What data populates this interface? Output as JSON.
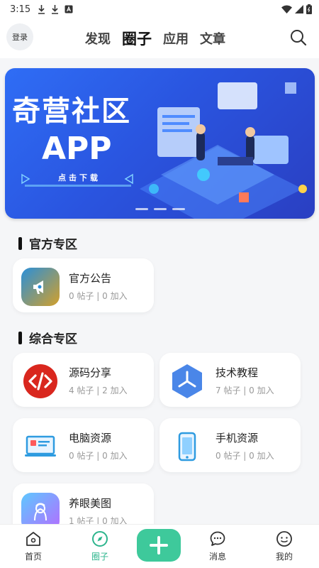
{
  "status_bar": {
    "time": "3:15"
  },
  "header": {
    "login_label": "登录",
    "tabs": [
      {
        "label": "发现",
        "active": false
      },
      {
        "label": "圈子",
        "active": true
      },
      {
        "label": "应用",
        "active": false
      },
      {
        "label": "文章",
        "active": false
      }
    ]
  },
  "banner": {
    "title": "奇营社区",
    "subtitle": "APP",
    "cta": "点击下载",
    "slide_count": 3
  },
  "sections": [
    {
      "title": "官方专区",
      "items": [
        {
          "name": "官方公告",
          "stats": "0 帖子 | 0 加入",
          "icon": "megaphone-icon",
          "color": "#2a8fd9"
        }
      ]
    },
    {
      "title": "综合专区",
      "items": [
        {
          "name": "源码分享",
          "stats": "4 帖子 | 2 加入",
          "icon": "code-icon",
          "color": "#d9271e"
        },
        {
          "name": "技术教程",
          "stats": "7 帖子 | 0 加入",
          "icon": "hexagon-icon",
          "color": "#4a86e8"
        },
        {
          "name": "电脑资源",
          "stats": "0 帖子 | 0 加入",
          "icon": "computer-icon",
          "color": "#2e9be0"
        },
        {
          "name": "手机资源",
          "stats": "0 帖子 | 0 加入",
          "icon": "phone-icon",
          "color": "#2e9be0"
        },
        {
          "name": "养眼美图",
          "stats": "1 帖子 | 0 加入",
          "icon": "portrait-icon",
          "color": "#6a7cf0"
        }
      ]
    }
  ],
  "bottom_nav": [
    {
      "label": "首页",
      "icon": "home-icon",
      "active": false
    },
    {
      "label": "圈子",
      "icon": "compass-icon",
      "active": true
    },
    {
      "label": "",
      "icon": "plus-icon",
      "active": false
    },
    {
      "label": "消息",
      "icon": "message-icon",
      "active": false
    },
    {
      "label": "我的",
      "icon": "profile-icon",
      "active": false
    }
  ],
  "colors": {
    "accent": "#3ec99b",
    "active_nav": "#2db58d"
  }
}
